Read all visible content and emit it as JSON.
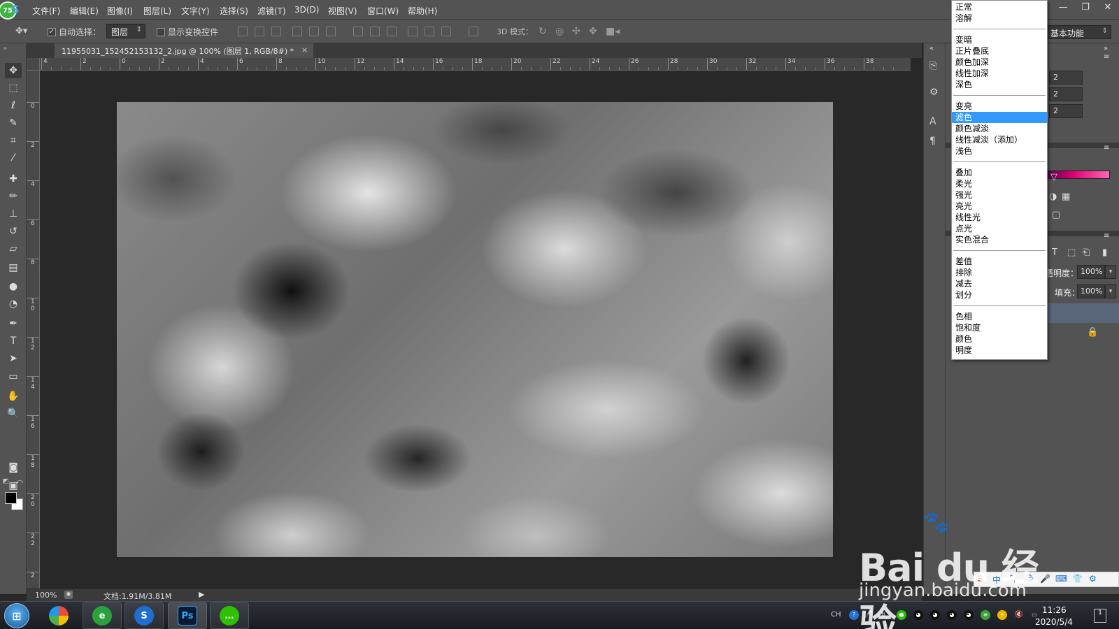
{
  "menubar": {
    "badge": "75",
    "app_letter": "S",
    "items": [
      "文件(F)",
      "编辑(E)",
      "图像(I)",
      "图层(L)",
      "文字(Y)",
      "选择(S)",
      "滤镜(T)",
      "3D(D)",
      "视图(V)",
      "窗口(W)",
      "帮助(H)"
    ],
    "win_minimize": "—",
    "win_restore": "❐",
    "win_close": "✕"
  },
  "options": {
    "auto_select_label": "自动选择：",
    "auto_select_checked": true,
    "layer_select_value": "图层",
    "show_transform_label": "显示变换控件",
    "show_transform_checked": false,
    "mode_3d_label": "3D 模式：",
    "workspace_value": "基本功能"
  },
  "document": {
    "tab_title": "11955031_152452153132_2.jpg @ 100% (图层 1, RGB/8#) *",
    "tab_close": "×",
    "ruler_h_labels": [
      "4",
      "2",
      "0",
      "2",
      "4",
      "6",
      "8",
      "10",
      "12",
      "14",
      "16",
      "18",
      "20",
      "22",
      "24",
      "26",
      "28",
      "30",
      "32",
      "34",
      "36",
      "38"
    ],
    "ruler_v_labels": [
      "0",
      "2",
      "4",
      "6",
      "8",
      "1\n0",
      "1\n2",
      "1\n4",
      "1\n6",
      "1\n8",
      "2\n0",
      "2\n2",
      "2"
    ]
  },
  "status": {
    "zoom": "100%",
    "doc_size": "文档:1.91M/3.81M",
    "arrow": "▶"
  },
  "right_panel": {
    "field_values": [
      "2",
      "2",
      "2"
    ],
    "opacity_label": "透明度：",
    "opacity_value": "100%",
    "fill_label": "填充：",
    "fill_value": "100%"
  },
  "blend_menu": {
    "groups": [
      [
        "正常",
        "溶解"
      ],
      [
        "变暗",
        "正片叠底",
        "颜色加深",
        "线性加深",
        "深色"
      ],
      [
        "变亮",
        "滤色",
        "颜色减淡",
        "线性减淡（添加）",
        "浅色"
      ],
      [
        "叠加",
        "柔光",
        "强光",
        "亮光",
        "线性光",
        "点光",
        "实色混合"
      ],
      [
        "差值",
        "排除",
        "减去",
        "划分"
      ],
      [
        "色相",
        "饱和度",
        "颜色",
        "明度"
      ]
    ],
    "selected": "滤色"
  },
  "ime": {
    "items": [
      "S",
      "中",
      "°,",
      "☺",
      "🎤",
      "⌨",
      "👕",
      "⚙"
    ]
  },
  "taskbar": {
    "apps": [
      {
        "name": "ie",
        "label": "e"
      },
      {
        "name": "sogou",
        "label": "S"
      },
      {
        "name": "photoshop",
        "label": "Ps"
      },
      {
        "name": "wechat",
        "label": "…"
      }
    ],
    "tray_lang": "CH",
    "time": "11:26",
    "date": "2020/5/4",
    "notify_count": "1"
  },
  "watermark": {
    "logo": "Bai du 经验",
    "url": "jingyan.baidu.com"
  },
  "colors": {
    "ui_panel": "#535353",
    "ui_dark": "#282828",
    "menu_highlight": "#3399ff",
    "layer_selected": "#596579"
  }
}
